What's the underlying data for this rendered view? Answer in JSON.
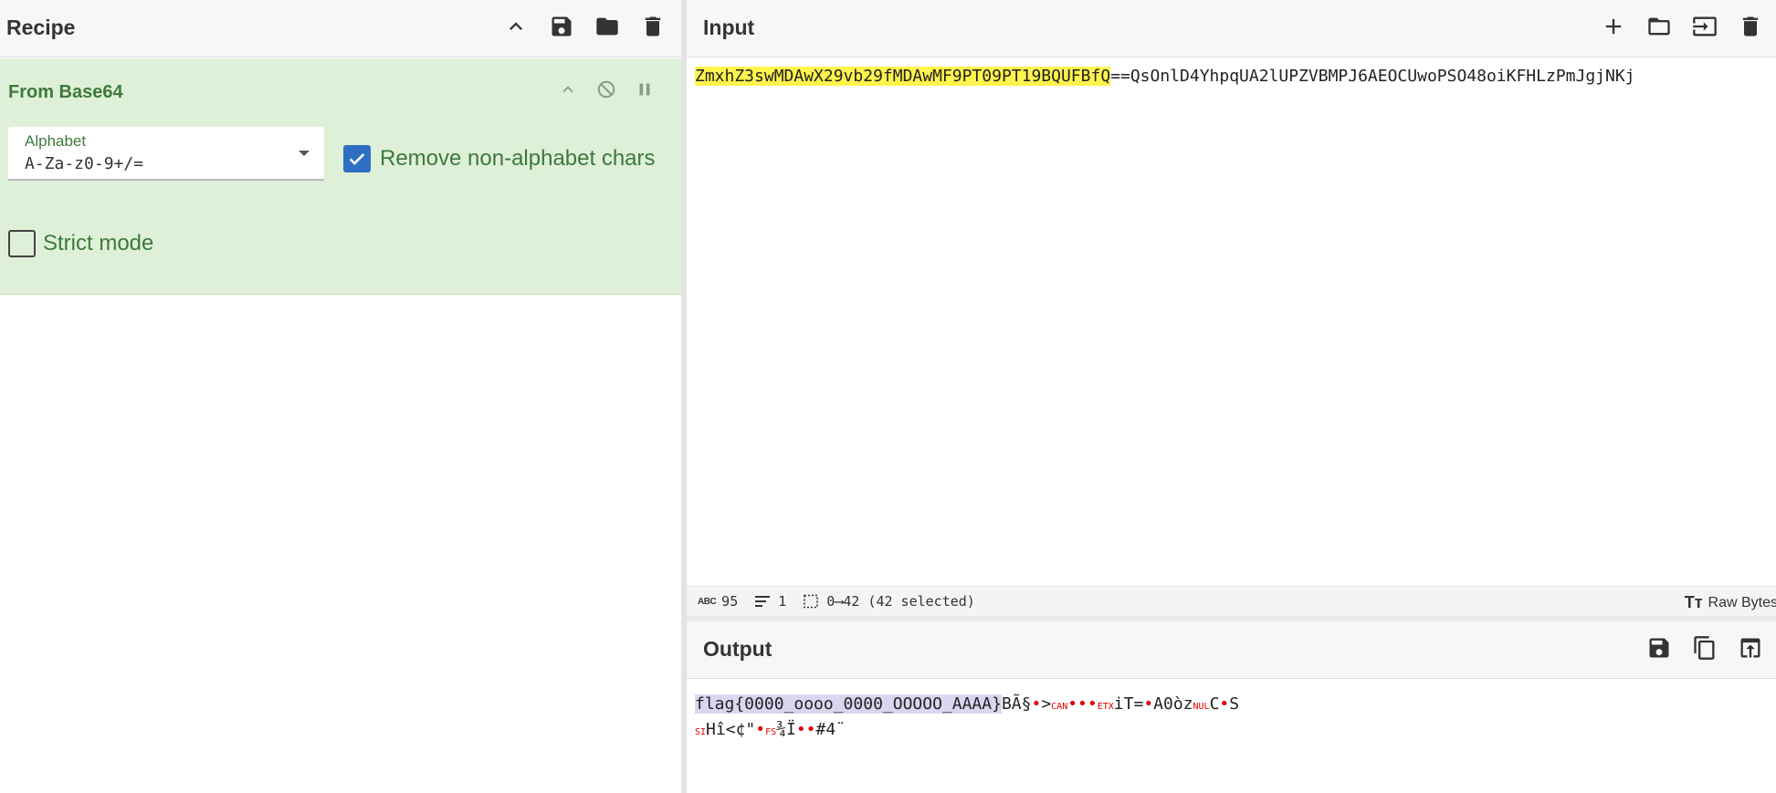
{
  "recipe": {
    "title": "Recipe",
    "operation": {
      "name": "From Base64",
      "alphabet_label": "Alphabet",
      "alphabet_value": "A-Za-z0-9+/=",
      "remove_non_alphabet_label": "Remove non-alphabet chars",
      "remove_non_alphabet_checked": true,
      "strict_mode_label": "Strict mode",
      "strict_mode_checked": false
    }
  },
  "input": {
    "title": "Input",
    "text_selected": "ZmxhZ3swMDAwX29vb29fMDAwMF9PT09PT19BQUFBfQ",
    "text_rest": "==QsOnlD4YhpqUA2lUPZVBMPJ6AEOCUwoPSO48oiKFHLzPmJgjNKj",
    "status": {
      "length": "95",
      "lines": "1",
      "selection": "0⟶42 (42 selected)",
      "encoding": "Raw Bytes"
    }
  },
  "output": {
    "title": "Output",
    "selected": "flag{0000_oooo_0000_OOOOO_AAAA}",
    "line1": [
      {
        "t": "BÃ§"
      },
      {
        "t": "•",
        "c": "dot"
      },
      {
        "t": ">"
      },
      {
        "t": "CAN",
        "c": "ctrl"
      },
      {
        "t": "•••",
        "c": "dot"
      },
      {
        "t": "ETX",
        "c": "ctrl"
      },
      {
        "t": "iT="
      },
      {
        "t": "•",
        "c": "dot"
      },
      {
        "t": "A0òz"
      },
      {
        "t": "NUL",
        "c": "ctrl"
      },
      {
        "t": "C"
      },
      {
        "t": "•",
        "c": "dot"
      },
      {
        "t": "S"
      }
    ],
    "line2": [
      {
        "t": "SI",
        "c": "ctrl"
      },
      {
        "t": "Hî<¢\""
      },
      {
        "t": "•",
        "c": "dot"
      },
      {
        "t": "FS",
        "c": "ctrl"
      },
      {
        "t": "¾Ï"
      },
      {
        "t": "••",
        "c": "dot"
      },
      {
        "t": "#4¨"
      }
    ]
  },
  "colors": {
    "accent_green": "#3c7a3c",
    "operation_bg": "#dff0d8",
    "checkbox_blue": "#2f6fc3",
    "input_highlight": "#fff34d",
    "output_highlight": "#dcd5f0",
    "control_char": "#e00000"
  },
  "icons": {
    "recipe_header": [
      "chevron-up-icon",
      "save-icon",
      "folder-icon",
      "trash-icon"
    ],
    "operation": [
      "chevron-up-icon",
      "disable-icon",
      "pause-icon"
    ],
    "input_header": [
      "plus-icon",
      "folder-icon",
      "import-icon",
      "trash-icon"
    ],
    "output_header": [
      "save-icon",
      "copy-icon",
      "replace-input-icon"
    ]
  }
}
